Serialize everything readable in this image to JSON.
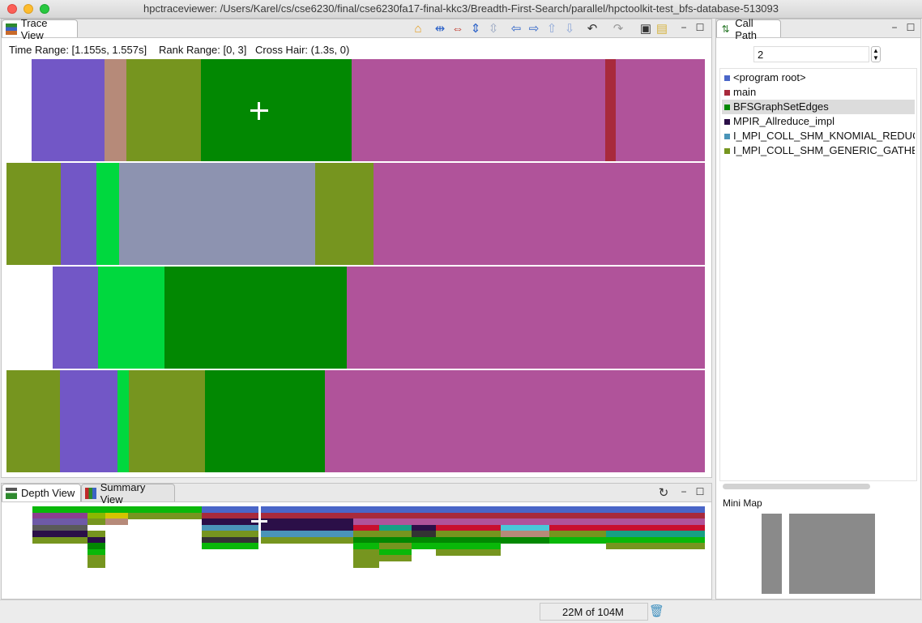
{
  "window": {
    "title": "hpctraceviewer: /Users/Karel/cs/cse6230/final/cse6230fa17-final-kkc3/Breadth-First-Search/parallel/hpctoolkit-test_bfs-database-513093"
  },
  "trace_view": {
    "tab_label": "Trace View",
    "toolbar_icons": [
      "home-icon",
      "zoom-in-time-icon",
      "zoom-out-time-icon",
      "zoom-in-rank-icon",
      "zoom-out-rank-icon",
      "go-left-icon",
      "go-right-icon",
      "go-up-icon",
      "go-down-icon",
      "undo-icon",
      "redo-icon",
      "save-icon",
      "open-icon"
    ],
    "time_range": "Time Range: [1.155s, 1.557s]",
    "rank_range": "Rank Range: [0, 3]",
    "cross_hair": "Cross Hair: (1.3s, 0)"
  },
  "trace_rows": [
    [
      {
        "w": 31,
        "c": "#ffffff"
      },
      {
        "w": 90,
        "c": "#7257c6"
      },
      {
        "w": 27,
        "c": "#b68a79"
      },
      {
        "w": 92,
        "c": "#76951f"
      },
      {
        "w": 186,
        "c": "#028802"
      },
      {
        "w": 313,
        "c": "#b0539a"
      },
      {
        "w": 13,
        "c": "#a82a3c"
      },
      {
        "w": 110,
        "c": "#b0539a"
      }
    ],
    [
      {
        "w": 67,
        "c": "#76951f"
      },
      {
        "w": 44,
        "c": "#7257c6"
      },
      {
        "w": 28,
        "c": "#00d83e"
      },
      {
        "w": 242,
        "c": "#8d93b0"
      },
      {
        "w": 72,
        "c": "#76951f"
      },
      {
        "w": 409,
        "c": "#b0539a"
      }
    ],
    [
      {
        "w": 57,
        "c": "#ffffff"
      },
      {
        "w": 56,
        "c": "#7257c6"
      },
      {
        "w": 82,
        "c": "#00d83e"
      },
      {
        "w": 225,
        "c": "#028802"
      },
      {
        "w": 442,
        "c": "#b0539a"
      }
    ],
    [
      {
        "w": 66,
        "c": "#76951f"
      },
      {
        "w": 71,
        "c": "#7257c6"
      },
      {
        "w": 14,
        "c": "#00d83e"
      },
      {
        "w": 94,
        "c": "#76951f"
      },
      {
        "w": 148,
        "c": "#028802"
      },
      {
        "w": 469,
        "c": "#b0539a"
      }
    ]
  ],
  "depth_view": {
    "tab_label": "Depth View",
    "summary_tab_label": "Summary View",
    "toolbar_icons": [
      "refresh-icon"
    ]
  },
  "call_path": {
    "tab_label": "Call Path",
    "depth_value": "2",
    "items": [
      {
        "label": "<program root>",
        "color": "#4a66c8"
      },
      {
        "label": "main",
        "color": "#a82a3c"
      },
      {
        "label": "BFSGraphSetEdges",
        "color": "#028802",
        "selected": true
      },
      {
        "label": "MPIR_Allreduce_impl",
        "color": "#2b0f48"
      },
      {
        "label": "I_MPI_COLL_SHM_KNOMIAL_REDUCE",
        "color": "#4a94b8"
      },
      {
        "label": "I_MPI_COLL_SHM_GENERIC_GATHER_",
        "color": "#76951f"
      }
    ]
  },
  "mini_map": {
    "label": "Mini Map"
  },
  "status": {
    "memory": "22M of 104M"
  }
}
